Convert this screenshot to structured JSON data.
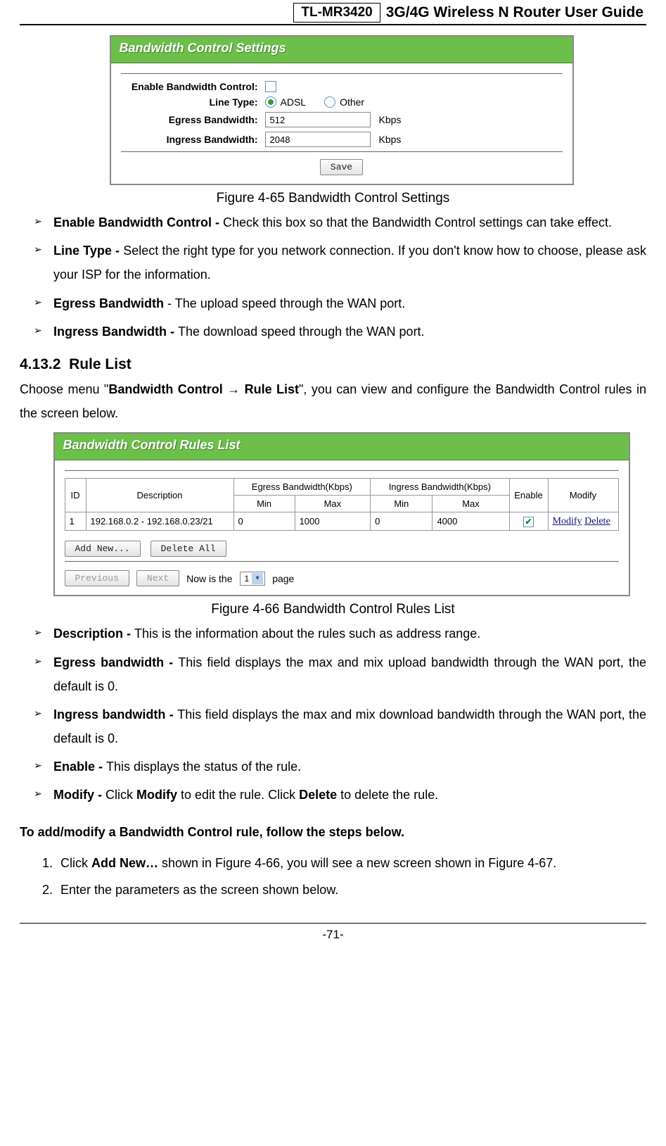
{
  "header": {
    "model": "TL-MR3420",
    "title": "3G/4G Wireless N Router User Guide"
  },
  "panel_settings": {
    "title": "Bandwidth Control Settings",
    "labels": {
      "enable": "Enable Bandwidth Control:",
      "line_type": "Line Type:",
      "egress": "Egress Bandwidth:",
      "ingress": "Ingress Bandwidth:"
    },
    "line_type": {
      "adsl": "ADSL",
      "other": "Other"
    },
    "egress_value": "512",
    "ingress_value": "2048",
    "unit": "Kbps",
    "save": "Save"
  },
  "caption1": "Figure 4-65 Bandwidth Control Settings",
  "settings_bullets": [
    {
      "term": "Enable Bandwidth Control - ",
      "text": "Check this box so that the Bandwidth Control settings can take effect."
    },
    {
      "term": "Line Type - ",
      "text": "Select the right type for you network connection. If you don't know how to choose, please ask your ISP for the information."
    },
    {
      "term": "Egress Bandwidth",
      "sep": " - ",
      "text": "The upload speed through the WAN port."
    },
    {
      "term": "Ingress Bandwidth - ",
      "text": "The download speed through the WAN port."
    }
  ],
  "section": {
    "num": "4.13.2",
    "title": "Rule List",
    "intro_a": "Choose menu \"",
    "intro_bold1": "Bandwidth Control",
    "intro_arrow": " → ",
    "intro_bold2": "Rule List",
    "intro_b": "\", you can view and configure the Bandwidth Control rules in the screen below."
  },
  "panel_rules": {
    "title": "Bandwidth Control Rules List",
    "headers": {
      "id": "ID",
      "desc": "Description",
      "egress": "Egress Bandwidth(Kbps)",
      "ingress": "Ingress Bandwidth(Kbps)",
      "min": "Min",
      "max": "Max",
      "enable": "Enable",
      "modify": "Modify"
    },
    "row": {
      "id": "1",
      "desc": "192.168.0.2 - 192.168.0.23/21",
      "emin": "0",
      "emax": "1000",
      "imin": "0",
      "imax": "4000",
      "modify_link": "Modify",
      "delete_link": "Delete"
    },
    "buttons": {
      "add": "Add New...",
      "delall": "Delete All",
      "prev": "Previous",
      "next": "Next"
    },
    "pager": {
      "label_a": "Now is the",
      "value": "1",
      "label_b": "page"
    }
  },
  "caption2": "Figure 4-66 Bandwidth Control Rules List",
  "rules_bullets": [
    {
      "term": "Description - ",
      "text": "This is the information about the rules such as address range."
    },
    {
      "term": "Egress bandwidth - ",
      "text": "This field displays the max and mix upload bandwidth through the WAN port, the default is 0."
    },
    {
      "term": "Ingress bandwidth - ",
      "text": "This field displays the max and mix download bandwidth through the WAN port, the default is 0."
    },
    {
      "term": "Enable - ",
      "text": "This displays the status of the rule."
    },
    {
      "term": "Modify - ",
      "text_a": "Click ",
      "bold_a": "Modify",
      "text_b": " to edit the rule. Click ",
      "bold_b": "Delete",
      "text_c": " to delete the rule."
    }
  ],
  "steps_heading": "To add/modify a Bandwidth Control rule, follow the steps below.",
  "steps": [
    {
      "a": "Click ",
      "bold": "Add New…",
      "b": " shown in Figure 4-66, you will see a new screen shown in Figure 4-67."
    },
    {
      "a": "Enter the parameters as the screen shown below."
    }
  ],
  "page_num": "-71-"
}
